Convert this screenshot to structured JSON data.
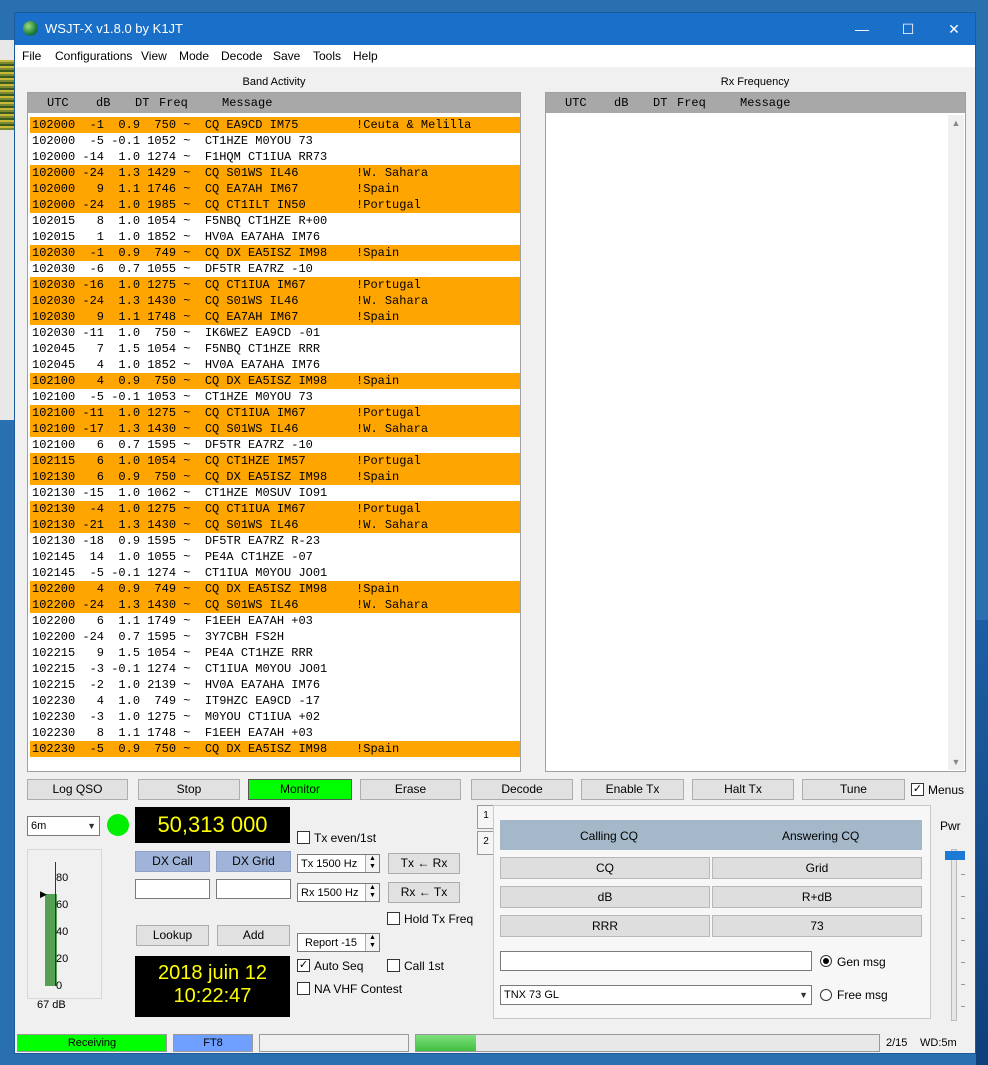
{
  "window": {
    "title": "WSJT-X   v1.8.0   by K1JT",
    "minimize": "—",
    "maximize": "☐",
    "close": "✕"
  },
  "menu": [
    "File",
    "Configurations",
    "View",
    "Mode",
    "Decode",
    "Save",
    "Tools",
    "Help"
  ],
  "band_activity": {
    "label": "Band Activity",
    "header": {
      "utc": "UTC",
      "db": "dB",
      "dt": "DT",
      "freq": "Freq",
      "message": "Message"
    },
    "rows": [
      {
        "t": "102000  -1  0.9  750 ~  CQ EA9CD IM75        !Ceuta & Melilla",
        "hl": true
      },
      {
        "t": "102000  -5 -0.1 1052 ~  CT1HZE M0YOU 73",
        "hl": false
      },
      {
        "t": "102000 -14  1.0 1274 ~  F1HQM CT1IUA RR73",
        "hl": false
      },
      {
        "t": "102000 -24  1.3 1429 ~  CQ S01WS IL46        !W. Sahara",
        "hl": true
      },
      {
        "t": "102000   9  1.1 1746 ~  CQ EA7AH IM67        !Spain",
        "hl": true
      },
      {
        "t": "102000 -24  1.0 1985 ~  CQ CT1ILT IN50       !Portugal",
        "hl": true
      },
      {
        "t": "102015   8  1.0 1054 ~  F5NBQ CT1HZE R+00",
        "hl": false
      },
      {
        "t": "102015   1  1.0 1852 ~  HV0A EA7AHA IM76",
        "hl": false
      },
      {
        "t": "102030  -1  0.9  749 ~  CQ DX EA5ISZ IM98    !Spain",
        "hl": true
      },
      {
        "t": "102030  -6  0.7 1055 ~  DF5TR EA7RZ -10",
        "hl": false
      },
      {
        "t": "102030 -16  1.0 1275 ~  CQ CT1IUA IM67       !Portugal",
        "hl": true
      },
      {
        "t": "102030 -24  1.3 1430 ~  CQ S01WS IL46        !W. Sahara",
        "hl": true
      },
      {
        "t": "102030   9  1.1 1748 ~  CQ EA7AH IM67        !Spain",
        "hl": true
      },
      {
        "t": "102030 -11  1.0  750 ~  IK6WEZ EA9CD -01",
        "hl": false
      },
      {
        "t": "102045   7  1.5 1054 ~  F5NBQ CT1HZE RRR",
        "hl": false
      },
      {
        "t": "102045   4  1.0 1852 ~  HV0A EA7AHA IM76",
        "hl": false
      },
      {
        "t": "102100   4  0.9  750 ~  CQ DX EA5ISZ IM98    !Spain",
        "hl": true
      },
      {
        "t": "102100  -5 -0.1 1053 ~  CT1HZE M0YOU 73",
        "hl": false
      },
      {
        "t": "102100 -11  1.0 1275 ~  CQ CT1IUA IM67       !Portugal",
        "hl": true
      },
      {
        "t": "102100 -17  1.3 1430 ~  CQ S01WS IL46        !W. Sahara",
        "hl": true
      },
      {
        "t": "102100   6  0.7 1595 ~  DF5TR EA7RZ -10",
        "hl": false
      },
      {
        "t": "102115   6  1.0 1054 ~  CQ CT1HZE IM57       !Portugal",
        "hl": true
      },
      {
        "t": "102130   6  0.9  750 ~  CQ DX EA5ISZ IM98    !Spain",
        "hl": true
      },
      {
        "t": "102130 -15  1.0 1062 ~  CT1HZE M0SUV IO91",
        "hl": false
      },
      {
        "t": "102130  -4  1.0 1275 ~  CQ CT1IUA IM67       !Portugal",
        "hl": true
      },
      {
        "t": "102130 -21  1.3 1430 ~  CQ S01WS IL46        !W. Sahara",
        "hl": true
      },
      {
        "t": "102130 -18  0.9 1595 ~  DF5TR EA7RZ R-23",
        "hl": false
      },
      {
        "t": "102145  14  1.0 1055 ~  PE4A CT1HZE -07",
        "hl": false
      },
      {
        "t": "102145  -5 -0.1 1274 ~  CT1IUA M0YOU JO01",
        "hl": false
      },
      {
        "t": "102200   4  0.9  749 ~  CQ DX EA5ISZ IM98    !Spain",
        "hl": true
      },
      {
        "t": "102200 -24  1.3 1430 ~  CQ S01WS IL46        !W. Sahara",
        "hl": true
      },
      {
        "t": "102200   6  1.1 1749 ~  F1EEH EA7AH +03",
        "hl": false
      },
      {
        "t": "102200 -24  0.7 1595 ~  3Y7CBH FS2H",
        "hl": false
      },
      {
        "t": "102215   9  1.5 1054 ~  PE4A CT1HZE RRR",
        "hl": false
      },
      {
        "t": "102215  -3 -0.1 1274 ~  CT1IUA M0YOU JO01",
        "hl": false
      },
      {
        "t": "102215  -2  1.0 2139 ~  HV0A EA7AHA IM76",
        "hl": false
      },
      {
        "t": "102230   4  1.0  749 ~  IT9HZC EA9CD -17",
        "hl": false
      },
      {
        "t": "102230  -3  1.0 1275 ~  M0YOU CT1IUA +02",
        "hl": false
      },
      {
        "t": "102230   8  1.1 1748 ~  F1EEH EA7AH +03",
        "hl": false
      },
      {
        "t": "102230  -5  0.9  750 ~  CQ DX EA5ISZ IM98    !Spain",
        "hl": true
      }
    ]
  },
  "rx_frequency": {
    "label": "Rx Frequency",
    "header": {
      "utc": "UTC",
      "db": "dB",
      "dt": "DT",
      "freq": "Freq",
      "message": "Message"
    }
  },
  "buttons": {
    "log_qso": "Log QSO",
    "stop": "Stop",
    "monitor": "Monitor",
    "erase": "Erase",
    "decode": "Decode",
    "enable_tx": "Enable Tx",
    "halt_tx": "Halt Tx",
    "tune": "Tune",
    "menus": "Menus"
  },
  "band": "6m",
  "frequency": "50,313 000",
  "dx_call": {
    "label": "DX Call",
    "value": ""
  },
  "dx_grid": {
    "label": "DX Grid",
    "value": ""
  },
  "lookup": "Lookup",
  "add": "Add",
  "date": "2018 juin 12",
  "time": "10:22:47",
  "meter": {
    "ticks": [
      "80",
      "60",
      "40",
      "20",
      "0"
    ],
    "reading": "67 dB",
    "level_db": 67
  },
  "controls": {
    "tx_even": "Tx even/1st",
    "tx_hz": "Tx  1500  Hz",
    "rx_hz": "Rx  1500  Hz",
    "tx_from_rx": "Tx ← Rx",
    "rx_from_tx": "Rx ← Tx",
    "hold_tx_freq": "Hold Tx Freq",
    "report": "Report -15",
    "auto_seq": "Auto Seq",
    "call_1st": "Call 1st",
    "na_vhf": "NA VHF Contest"
  },
  "tabs": [
    "1",
    "2"
  ],
  "tx_panel": {
    "calling_cq": "Calling CQ",
    "answering_cq": "Answering CQ",
    "cq": "CQ",
    "grid": "Grid",
    "db": "dB",
    "r_db": "R+dB",
    "rrr": "RRR",
    "seventy_three": "73",
    "gen_msg": "Gen msg",
    "free_msg": "Free msg",
    "free_text": "TNX 73 GL"
  },
  "pwr": "Pwr",
  "status": {
    "receiving": "Receiving",
    "mode": "FT8",
    "progress": "2/15",
    "wd": "WD:5m",
    "progress_fraction": 0.13
  }
}
